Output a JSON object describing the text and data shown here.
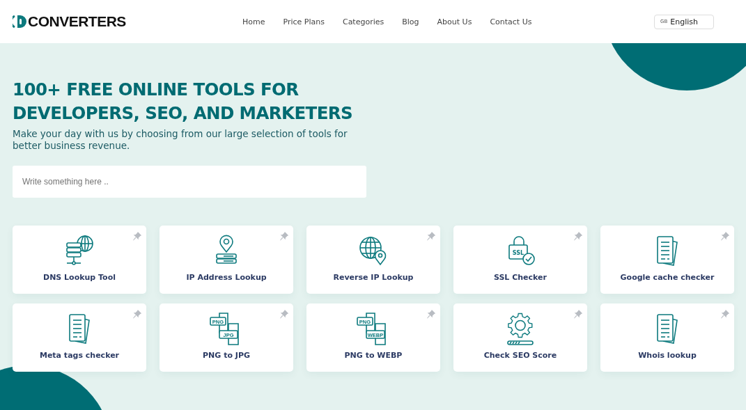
{
  "logo": {
    "text": "CONVERTERS"
  },
  "nav": [
    {
      "label": "Home"
    },
    {
      "label": "Price Plans"
    },
    {
      "label": "Categories"
    },
    {
      "label": "Blog"
    },
    {
      "label": "About Us"
    },
    {
      "label": "Contact Us"
    }
  ],
  "language": {
    "flag": "GB",
    "label": "English"
  },
  "hero": {
    "title_lines": [
      "100+ FREE ONLINE TOOLS FOR",
      "DEVELOPERS, SEO, AND MARKETERS"
    ],
    "subtitle": "Make your day with us by choosing from our large selection of tools for better business revenue.",
    "search": {
      "placeholder": "Write something here .."
    }
  },
  "tools": [
    {
      "name": "DNS Lookup Tool",
      "kind": "dns"
    },
    {
      "name": "IP Address Lookup",
      "kind": "location"
    },
    {
      "name": "Reverse IP Lookup",
      "kind": "globe"
    },
    {
      "name": "SSL Checker",
      "kind": "lock",
      "badges": [
        "SSL"
      ]
    },
    {
      "name": "Google cache checker",
      "kind": "document"
    },
    {
      "name": "Meta tags checker",
      "kind": "document"
    },
    {
      "name": "PNG to JPG",
      "kind": "convert",
      "badges": [
        "PNG",
        "JPG"
      ]
    },
    {
      "name": "PNG to WEBP",
      "kind": "convert",
      "badges": [
        "PNG",
        "WEBP"
      ]
    },
    {
      "name": "Check SEO Score",
      "kind": "gear"
    },
    {
      "name": "Whois lookup",
      "kind": "document"
    }
  ]
}
